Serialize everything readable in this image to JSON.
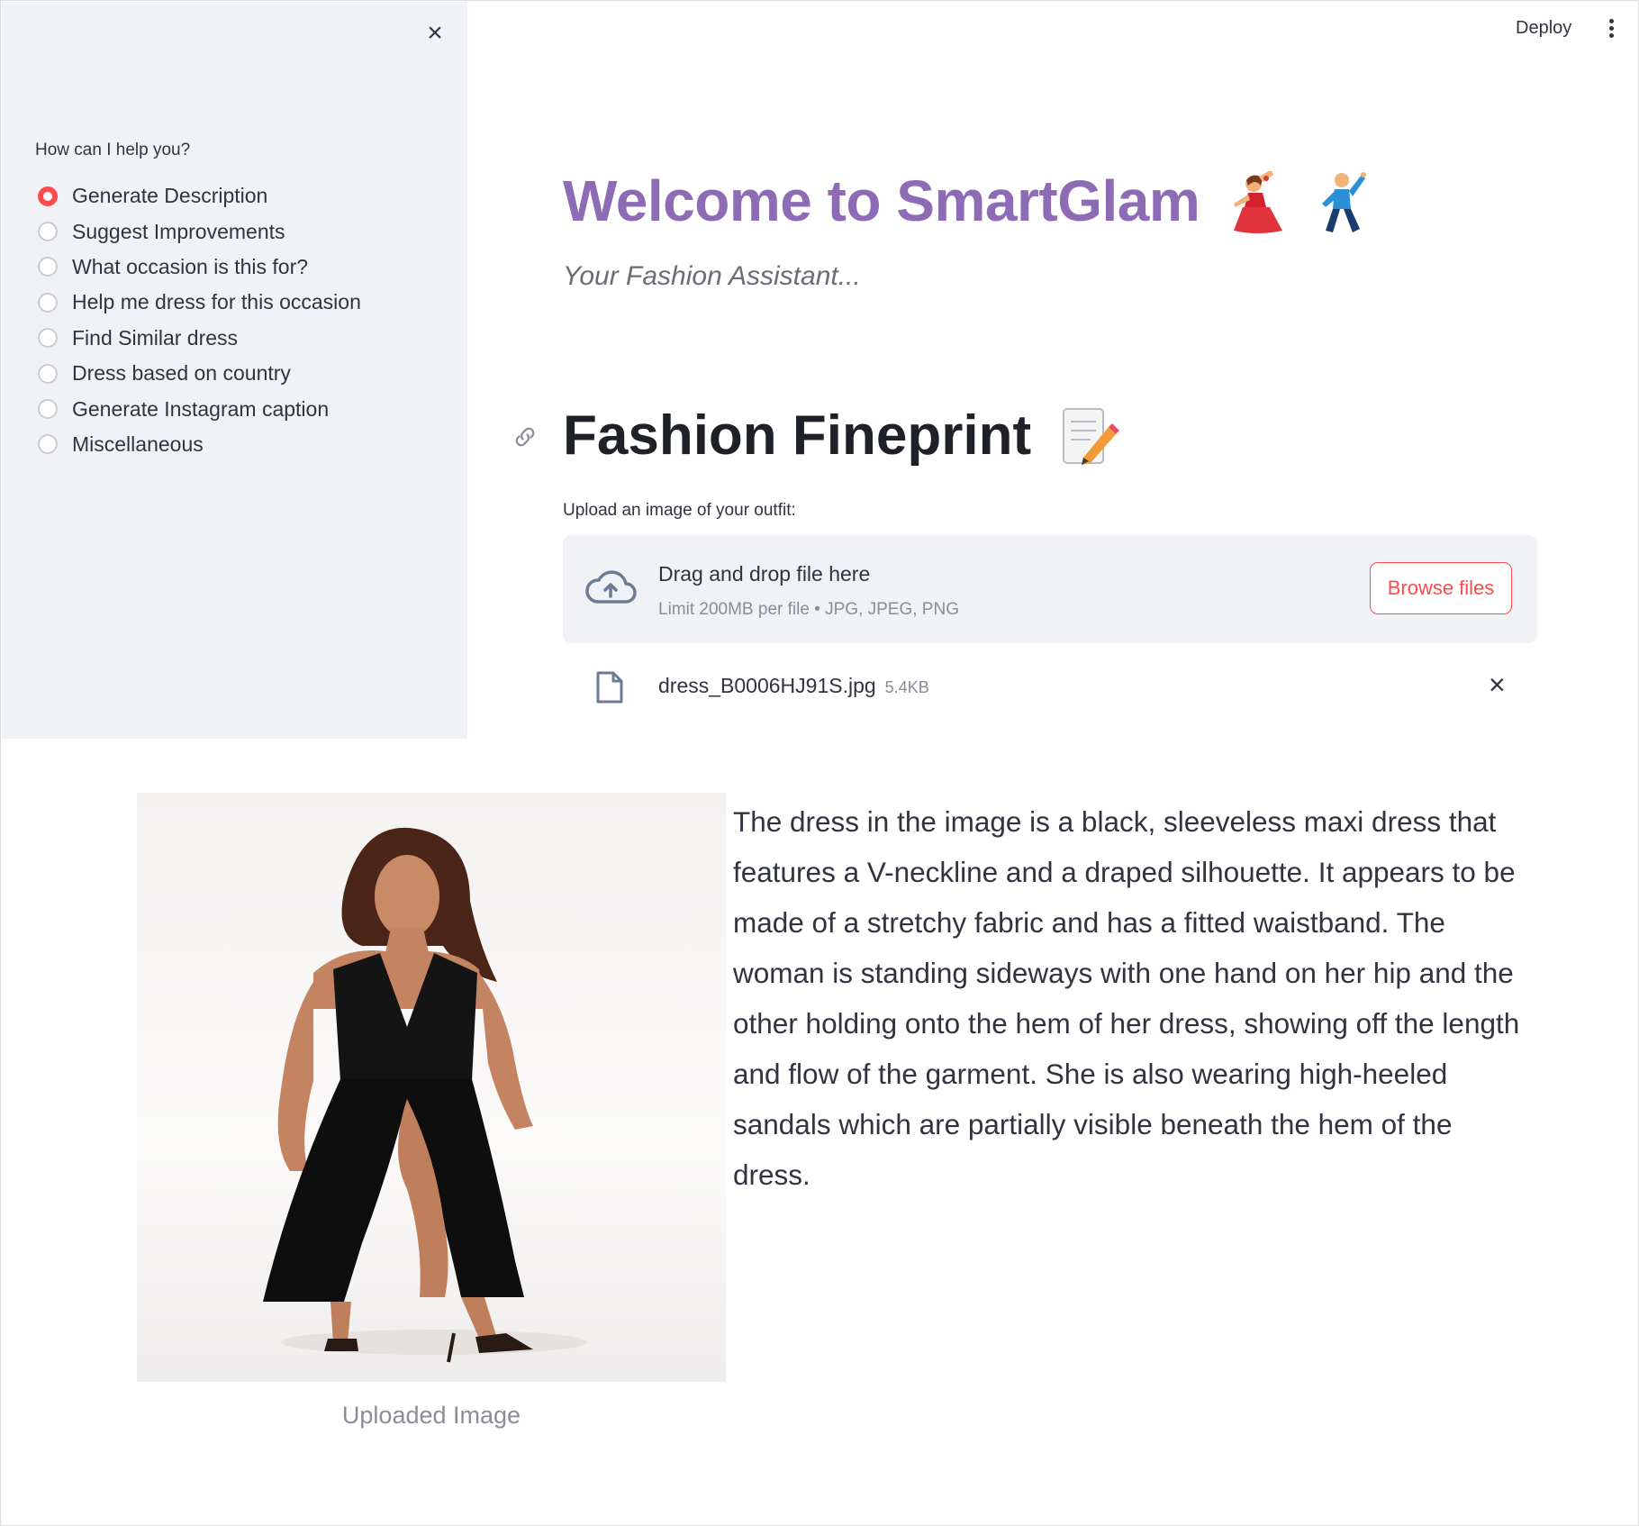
{
  "sidebar": {
    "close_icon": "close-icon",
    "label": "How can I help you?",
    "options": [
      {
        "label": "Generate Description",
        "selected": true
      },
      {
        "label": "Suggest Improvements",
        "selected": false
      },
      {
        "label": "What occasion is this for?",
        "selected": false
      },
      {
        "label": "Help me dress for this occasion",
        "selected": false
      },
      {
        "label": "Find Similar dress",
        "selected": false
      },
      {
        "label": "Dress based on country",
        "selected": false
      },
      {
        "label": "Generate Instagram caption",
        "selected": false
      },
      {
        "label": "Miscellaneous",
        "selected": false
      }
    ]
  },
  "header": {
    "deploy_label": "Deploy",
    "menu_icon": "kebab-menu-icon"
  },
  "main": {
    "title": "Welcome to SmartGlam",
    "title_icons": [
      "woman-dancing-icon",
      "man-dancing-icon"
    ],
    "subtitle": "Your Fashion Assistant...",
    "section_title": "Fashion Fineprint",
    "section_icon": "memo-icon",
    "upload_label": "Upload an image of your outfit:",
    "dropzone": {
      "main_text": "Drag and drop file here",
      "sub_text": "Limit 200MB per file • JPG, JPEG, PNG",
      "browse_label": "Browse files"
    },
    "file": {
      "name": "dress_B0006HJ91S.jpg",
      "size": "5.4KB"
    },
    "image_caption": "Uploaded Image",
    "description": "The dress in the image is a black, sleeveless maxi dress that features a V-neckline and a draped silhouette. It appears to be made of a stretchy fabric and has a fitted waistband. The woman is standing sideways with one hand on her hip and the other holding onto the hem of her dress, showing off the length and flow of the garment. She is also wearing high-heeled sandals which are partially visible beneath the hem of the dress."
  },
  "colors": {
    "accent": "#ff4b4b",
    "title": "#8d6cb5",
    "sidebar_bg": "#f0f2f6",
    "text": "#31333f"
  }
}
